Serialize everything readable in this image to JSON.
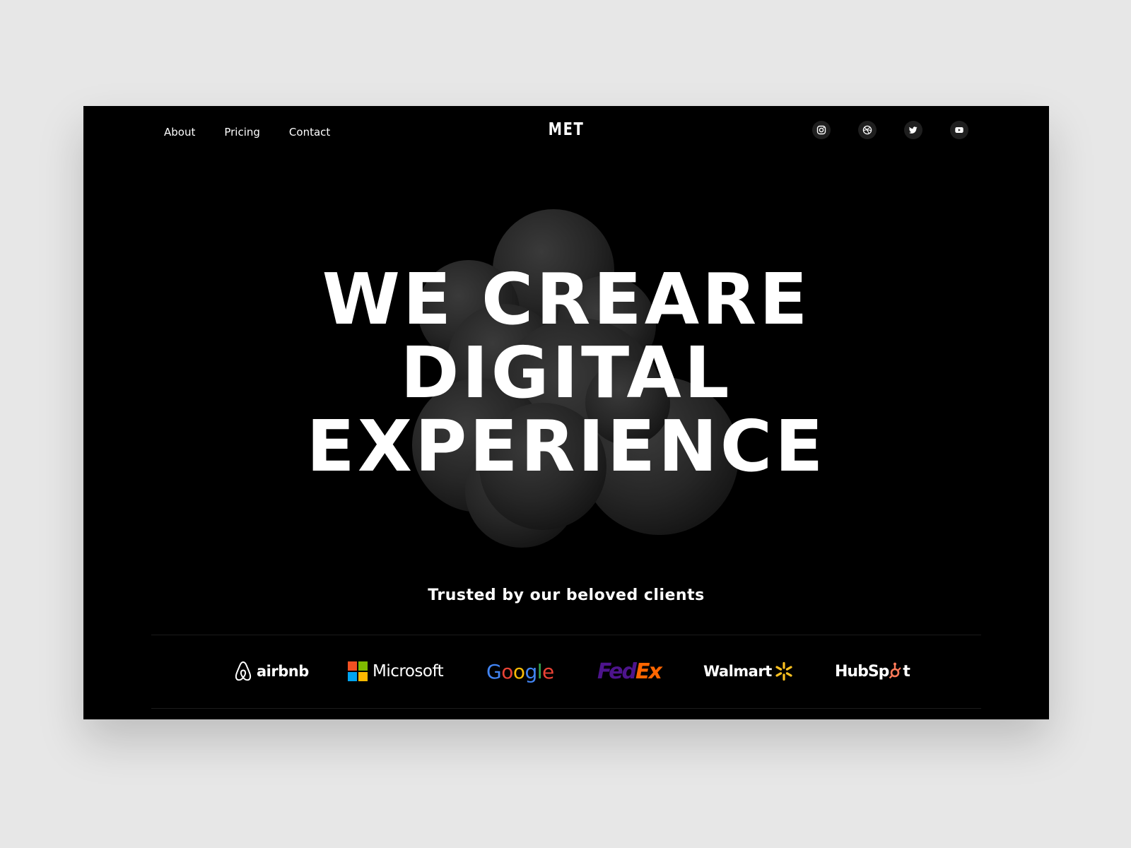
{
  "nav": {
    "links": [
      "About",
      "Pricing",
      "Contact"
    ],
    "logo": "MET",
    "social_icons": [
      "instagram-icon",
      "dribbble-icon",
      "twitter-icon",
      "youtube-icon"
    ]
  },
  "hero": {
    "lines": [
      "WE CREARE",
      "DIGITAL",
      "EXPERIENCE"
    ]
  },
  "clients": {
    "heading": "Trusted by our beloved clients",
    "logos": {
      "airbnb": "airbnb",
      "microsoft": "Microsoft",
      "google_letters": [
        "G",
        "o",
        "o",
        "g",
        "l",
        "e"
      ],
      "fedex_fed": "Fed",
      "fedex_ex": "Ex",
      "walmart": "Walmart",
      "hubspot_pre": "HubSp",
      "hubspot_post": "t"
    }
  },
  "colors": {
    "background": "#000000",
    "page": "#e7e7e7",
    "text": "#ffffff",
    "google": [
      "#4285F4",
      "#EA4335",
      "#FBBC05",
      "#4285F4",
      "#34A853",
      "#EA4335"
    ],
    "fedex_purple": "#4D148C",
    "fedex_orange": "#FF6600",
    "walmart_spark": "#FFC220",
    "hubspot_orange": "#FF7A59",
    "microsoft": [
      "#F25022",
      "#7FBA00",
      "#00A4EF",
      "#FFB900"
    ]
  }
}
